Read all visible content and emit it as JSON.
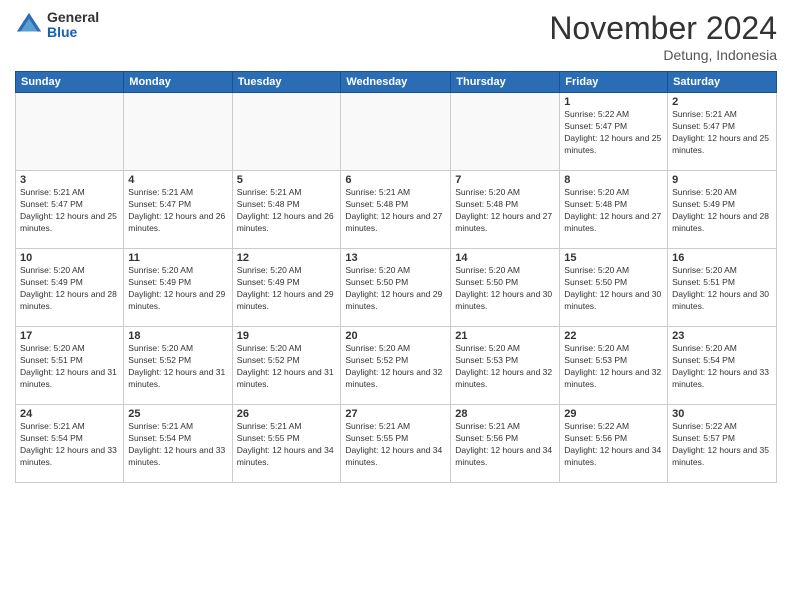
{
  "header": {
    "logo_general": "General",
    "logo_blue": "Blue",
    "month_title": "November 2024",
    "location": "Detung, Indonesia"
  },
  "days_of_week": [
    "Sunday",
    "Monday",
    "Tuesday",
    "Wednesday",
    "Thursday",
    "Friday",
    "Saturday"
  ],
  "weeks": [
    [
      {
        "day": "",
        "empty": true
      },
      {
        "day": "",
        "empty": true
      },
      {
        "day": "",
        "empty": true
      },
      {
        "day": "",
        "empty": true
      },
      {
        "day": "",
        "empty": true
      },
      {
        "day": "1",
        "sunrise": "5:22 AM",
        "sunset": "5:47 PM",
        "daylight": "12 hours and 25 minutes."
      },
      {
        "day": "2",
        "sunrise": "5:21 AM",
        "sunset": "5:47 PM",
        "daylight": "12 hours and 25 minutes."
      }
    ],
    [
      {
        "day": "3",
        "sunrise": "5:21 AM",
        "sunset": "5:47 PM",
        "daylight": "12 hours and 25 minutes."
      },
      {
        "day": "4",
        "sunrise": "5:21 AM",
        "sunset": "5:47 PM",
        "daylight": "12 hours and 26 minutes."
      },
      {
        "day": "5",
        "sunrise": "5:21 AM",
        "sunset": "5:48 PM",
        "daylight": "12 hours and 26 minutes."
      },
      {
        "day": "6",
        "sunrise": "5:21 AM",
        "sunset": "5:48 PM",
        "daylight": "12 hours and 27 minutes."
      },
      {
        "day": "7",
        "sunrise": "5:20 AM",
        "sunset": "5:48 PM",
        "daylight": "12 hours and 27 minutes."
      },
      {
        "day": "8",
        "sunrise": "5:20 AM",
        "sunset": "5:48 PM",
        "daylight": "12 hours and 27 minutes."
      },
      {
        "day": "9",
        "sunrise": "5:20 AM",
        "sunset": "5:49 PM",
        "daylight": "12 hours and 28 minutes."
      }
    ],
    [
      {
        "day": "10",
        "sunrise": "5:20 AM",
        "sunset": "5:49 PM",
        "daylight": "12 hours and 28 minutes."
      },
      {
        "day": "11",
        "sunrise": "5:20 AM",
        "sunset": "5:49 PM",
        "daylight": "12 hours and 29 minutes."
      },
      {
        "day": "12",
        "sunrise": "5:20 AM",
        "sunset": "5:49 PM",
        "daylight": "12 hours and 29 minutes."
      },
      {
        "day": "13",
        "sunrise": "5:20 AM",
        "sunset": "5:50 PM",
        "daylight": "12 hours and 29 minutes."
      },
      {
        "day": "14",
        "sunrise": "5:20 AM",
        "sunset": "5:50 PM",
        "daylight": "12 hours and 30 minutes."
      },
      {
        "day": "15",
        "sunrise": "5:20 AM",
        "sunset": "5:50 PM",
        "daylight": "12 hours and 30 minutes."
      },
      {
        "day": "16",
        "sunrise": "5:20 AM",
        "sunset": "5:51 PM",
        "daylight": "12 hours and 30 minutes."
      }
    ],
    [
      {
        "day": "17",
        "sunrise": "5:20 AM",
        "sunset": "5:51 PM",
        "daylight": "12 hours and 31 minutes."
      },
      {
        "day": "18",
        "sunrise": "5:20 AM",
        "sunset": "5:52 PM",
        "daylight": "12 hours and 31 minutes."
      },
      {
        "day": "19",
        "sunrise": "5:20 AM",
        "sunset": "5:52 PM",
        "daylight": "12 hours and 31 minutes."
      },
      {
        "day": "20",
        "sunrise": "5:20 AM",
        "sunset": "5:52 PM",
        "daylight": "12 hours and 32 minutes."
      },
      {
        "day": "21",
        "sunrise": "5:20 AM",
        "sunset": "5:53 PM",
        "daylight": "12 hours and 32 minutes."
      },
      {
        "day": "22",
        "sunrise": "5:20 AM",
        "sunset": "5:53 PM",
        "daylight": "12 hours and 32 minutes."
      },
      {
        "day": "23",
        "sunrise": "5:20 AM",
        "sunset": "5:54 PM",
        "daylight": "12 hours and 33 minutes."
      }
    ],
    [
      {
        "day": "24",
        "sunrise": "5:21 AM",
        "sunset": "5:54 PM",
        "daylight": "12 hours and 33 minutes."
      },
      {
        "day": "25",
        "sunrise": "5:21 AM",
        "sunset": "5:54 PM",
        "daylight": "12 hours and 33 minutes."
      },
      {
        "day": "26",
        "sunrise": "5:21 AM",
        "sunset": "5:55 PM",
        "daylight": "12 hours and 34 minutes."
      },
      {
        "day": "27",
        "sunrise": "5:21 AM",
        "sunset": "5:55 PM",
        "daylight": "12 hours and 34 minutes."
      },
      {
        "day": "28",
        "sunrise": "5:21 AM",
        "sunset": "5:56 PM",
        "daylight": "12 hours and 34 minutes."
      },
      {
        "day": "29",
        "sunrise": "5:22 AM",
        "sunset": "5:56 PM",
        "daylight": "12 hours and 34 minutes."
      },
      {
        "day": "30",
        "sunrise": "5:22 AM",
        "sunset": "5:57 PM",
        "daylight": "12 hours and 35 minutes."
      }
    ]
  ]
}
